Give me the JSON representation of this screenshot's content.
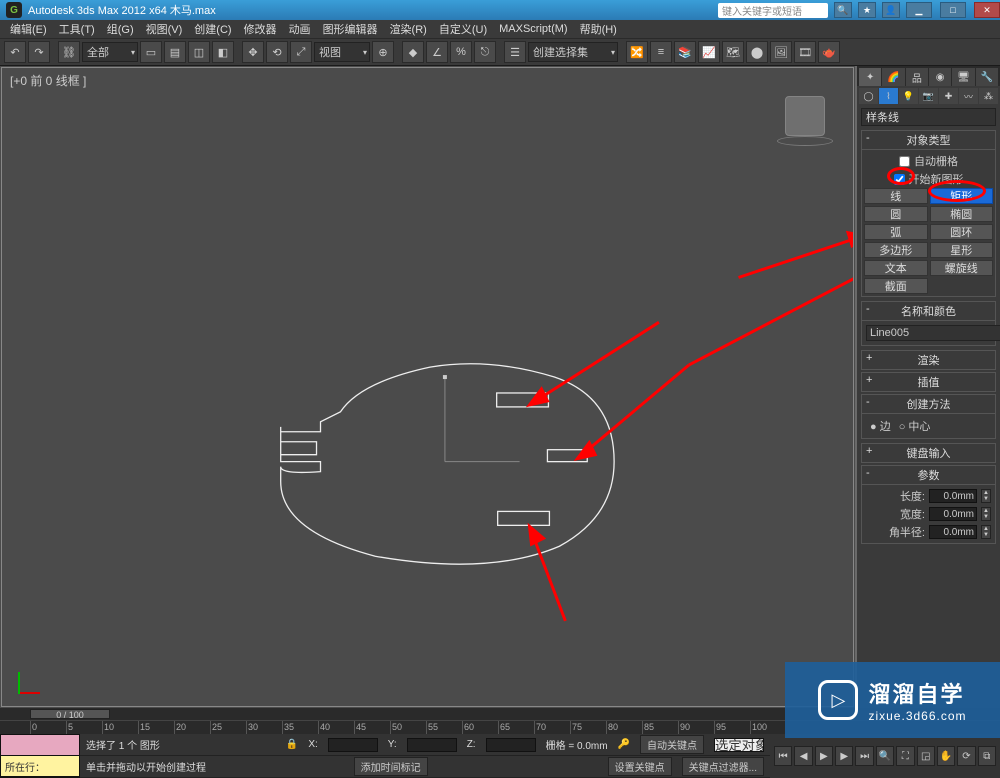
{
  "titlebar": {
    "title": "Autodesk 3ds Max  2012 x64    木马.max",
    "search_placeholder": "键入关键字或短语",
    "min": "▁",
    "max": "□",
    "close": "✕"
  },
  "menu": [
    "编辑(E)",
    "工具(T)",
    "组(G)",
    "视图(V)",
    "创建(C)",
    "修改器",
    "动画",
    "图形编辑器",
    "渲染(R)",
    "自定义(U)",
    "MAXScript(M)",
    "帮助(H)"
  ],
  "toolbar": {
    "layer_dd": "全部",
    "view_dd": "视图",
    "selset_dd": "创建选择集"
  },
  "viewport": {
    "label": "[+0 前 0 线框 ]"
  },
  "panel": {
    "spline_dd": "样条线",
    "rollout_objtype": "对象类型",
    "autogrid": "自动栅格",
    "startnew": "开始新图形",
    "btns": {
      "line": "线",
      "rect": "矩形",
      "circle": "圆",
      "ellipse": "椭圆",
      "arc": "弧",
      "donut": "圆环",
      "ngon": "多边形",
      "star": "星形",
      "text": "文本",
      "helix": "螺旋线",
      "section": "截面"
    },
    "rollout_namecolor": "名称和颜色",
    "obj_name": "Line005",
    "rollout_render": "渲染",
    "rollout_interp": "插值",
    "rollout_method": "创建方法",
    "method_edge": "边",
    "method_center": "中心",
    "rollout_kbd": "键盘输入",
    "rollout_params": "参数",
    "length_lbl": "长度:",
    "length_val": "0.0mm",
    "width_lbl": "宽度:",
    "width_val": "0.0mm",
    "radius_lbl": "角半径:",
    "radius_val": "0.0mm"
  },
  "timeslider": {
    "handle": "0 / 100"
  },
  "status": {
    "sel": "选择了 1 个 图形",
    "prompt": "单击并拖动以开始创建过程",
    "x": "X:",
    "y": "Y:",
    "z": "Z:",
    "grid": "栅格 = 0.0mm",
    "addtime": "添加时间标记",
    "autokey": "自动关键点",
    "setkey": "设置关键点",
    "selset": "选定对象",
    "keyfilter": "关键点过滤器...",
    "locrow": "所在行："
  },
  "watermark": {
    "big": "溜溜自学",
    "small": "zixue.3d66.com"
  }
}
